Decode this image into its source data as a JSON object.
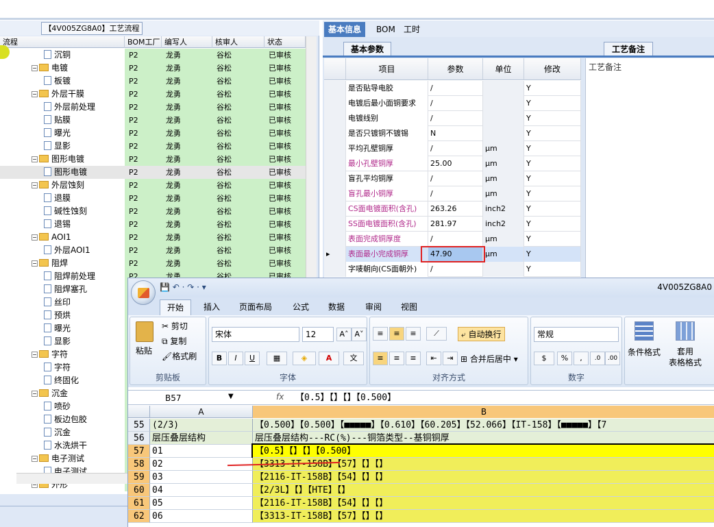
{
  "left_panel": {
    "tab_title": "【4V005ZG8A0】工艺流程",
    "columns": [
      "流程",
      "BOM工厂",
      "编写人",
      "核审人",
      "状态"
    ],
    "rows": [
      {
        "indent": 2,
        "kind": "doc",
        "name": "沉铜",
        "bom": "P2",
        "writer": "龙勇",
        "reviewer": "谷松",
        "status": "已审核"
      },
      {
        "indent": 1,
        "kind": "folder",
        "name": "电镀",
        "bom": "P2",
        "writer": "龙勇",
        "reviewer": "谷松",
        "status": "已审核"
      },
      {
        "indent": 2,
        "kind": "doc",
        "name": "板镀",
        "bom": "P2",
        "writer": "龙勇",
        "reviewer": "谷松",
        "status": "已审核"
      },
      {
        "indent": 1,
        "kind": "folder",
        "name": "外层干膜",
        "bom": "P2",
        "writer": "龙勇",
        "reviewer": "谷松",
        "status": "已审核"
      },
      {
        "indent": 2,
        "kind": "doc",
        "name": "外层前处理",
        "bom": "P2",
        "writer": "龙勇",
        "reviewer": "谷松",
        "status": "已审核"
      },
      {
        "indent": 2,
        "kind": "doc",
        "name": "贴膜",
        "bom": "P2",
        "writer": "龙勇",
        "reviewer": "谷松",
        "status": "已审核"
      },
      {
        "indent": 2,
        "kind": "doc",
        "name": "曝光",
        "bom": "P2",
        "writer": "龙勇",
        "reviewer": "谷松",
        "status": "已审核"
      },
      {
        "indent": 2,
        "kind": "doc",
        "name": "显影",
        "bom": "P2",
        "writer": "龙勇",
        "reviewer": "谷松",
        "status": "已审核"
      },
      {
        "indent": 1,
        "kind": "folder",
        "name": "图形电镀",
        "bom": "P2",
        "writer": "龙勇",
        "reviewer": "谷松",
        "status": "已审核"
      },
      {
        "indent": 2,
        "kind": "doc",
        "name": "图形电镀",
        "bom": "P2",
        "writer": "龙勇",
        "reviewer": "谷松",
        "status": "已审核",
        "selected": true
      },
      {
        "indent": 1,
        "kind": "folder",
        "name": "外层蚀刻",
        "bom": "P2",
        "writer": "龙勇",
        "reviewer": "谷松",
        "status": "已审核"
      },
      {
        "indent": 2,
        "kind": "doc",
        "name": "退膜",
        "bom": "P2",
        "writer": "龙勇",
        "reviewer": "谷松",
        "status": "已审核"
      },
      {
        "indent": 2,
        "kind": "doc",
        "name": "碱性蚀刻",
        "bom": "P2",
        "writer": "龙勇",
        "reviewer": "谷松",
        "status": "已审核"
      },
      {
        "indent": 2,
        "kind": "doc",
        "name": "退锡",
        "bom": "P2",
        "writer": "龙勇",
        "reviewer": "谷松",
        "status": "已审核"
      },
      {
        "indent": 1,
        "kind": "folder",
        "name": "AOI1",
        "bom": "P2",
        "writer": "龙勇",
        "reviewer": "谷松",
        "status": "已审核"
      },
      {
        "indent": 2,
        "kind": "doc",
        "name": "外层AOI1",
        "bom": "P2",
        "writer": "龙勇",
        "reviewer": "谷松",
        "status": "已审核"
      },
      {
        "indent": 1,
        "kind": "folder",
        "name": "阻焊",
        "bom": "P2",
        "writer": "龙勇",
        "reviewer": "谷松",
        "status": "已审核"
      },
      {
        "indent": 2,
        "kind": "doc",
        "name": "阻焊前处理",
        "bom": "P2",
        "writer": "龙勇",
        "reviewer": "谷松",
        "status": "已审核"
      },
      {
        "indent": 2,
        "kind": "doc",
        "name": "阻焊塞孔"
      },
      {
        "indent": 2,
        "kind": "doc",
        "name": "丝印"
      },
      {
        "indent": 2,
        "kind": "doc",
        "name": "预烘"
      },
      {
        "indent": 2,
        "kind": "doc",
        "name": "曝光"
      },
      {
        "indent": 2,
        "kind": "doc",
        "name": "显影"
      },
      {
        "indent": 1,
        "kind": "folder",
        "name": "字符"
      },
      {
        "indent": 2,
        "kind": "doc",
        "name": "字符"
      },
      {
        "indent": 2,
        "kind": "doc",
        "name": "终固化"
      },
      {
        "indent": 1,
        "kind": "folder",
        "name": "沉金"
      },
      {
        "indent": 2,
        "kind": "doc",
        "name": "喷砂"
      },
      {
        "indent": 2,
        "kind": "doc",
        "name": "板边包胶"
      },
      {
        "indent": 2,
        "kind": "doc",
        "name": "沉金"
      },
      {
        "indent": 2,
        "kind": "doc",
        "name": "水洗烘干"
      },
      {
        "indent": 1,
        "kind": "folder",
        "name": "电子测试"
      },
      {
        "indent": 2,
        "kind": "doc",
        "name": "电子测试"
      },
      {
        "indent": 1,
        "kind": "folder",
        "name": "外形"
      }
    ]
  },
  "right_panel": {
    "tabs": [
      "基本信息",
      "BOM",
      "工时"
    ],
    "subtab": "基本参数",
    "notes_tab": "工艺备注",
    "notes_label": "工艺备注",
    "columns": [
      "项目",
      "参数",
      "单位",
      "修改"
    ],
    "rows": [
      {
        "item": "是否贴导电胶",
        "param": "/",
        "unit": "",
        "mod": "Y"
      },
      {
        "item": "电镀后最小面铜要求",
        "param": "/",
        "unit": "",
        "mod": "Y"
      },
      {
        "item": "电镀线别",
        "param": "/",
        "unit": "",
        "mod": "Y"
      },
      {
        "item": "是否只镀铜不镀锡",
        "param": "N",
        "unit": "",
        "mod": "Y"
      },
      {
        "item": "平均孔壁铜厚",
        "param": "/",
        "unit": "μm",
        "mod": "Y"
      },
      {
        "item": "最小孔壁铜厚",
        "param": "25.00",
        "unit": "μm",
        "mod": "Y",
        "pink": true
      },
      {
        "item": "盲孔平均铜厚",
        "param": "/",
        "unit": "μm",
        "mod": "Y"
      },
      {
        "item": "盲孔最小铜厚",
        "param": "/",
        "unit": "μm",
        "mod": "Y",
        "pink": true
      },
      {
        "item": "CS面电镀面积(含孔)",
        "param": "263.26",
        "unit": "inch2",
        "mod": "Y",
        "pink": true
      },
      {
        "item": "SS面电镀面积(含孔)",
        "param": "281.97",
        "unit": "inch2",
        "mod": "Y",
        "pink": true
      },
      {
        "item": "表面完成铜厚度",
        "param": "/",
        "unit": "μm",
        "mod": "Y",
        "pink": true
      },
      {
        "item": "表面最小完成铜厚",
        "param": "47.90",
        "unit": "μm",
        "mod": "Y",
        "pink": true,
        "selected": true
      },
      {
        "item": "字唛朝向(CS面朝外)",
        "param": "/",
        "unit": "",
        "mod": "Y"
      }
    ]
  },
  "excel": {
    "title": "4V005ZG8A0",
    "tabs": [
      "开始",
      "插入",
      "页面布局",
      "公式",
      "数据",
      "审阅",
      "视图"
    ],
    "clipboard": {
      "paste": "粘贴",
      "cut": "剪切",
      "copy": "复制",
      "format_painter": "格式刷",
      "label": "剪贴板"
    },
    "font": {
      "name": "宋体",
      "size": "12",
      "label": "字体",
      "bold": "B",
      "italic": "I",
      "underline": "U"
    },
    "alignment": {
      "wrap": "自动换行",
      "merge": "合并后居中",
      "label": "对齐方式"
    },
    "number": {
      "format": "常规",
      "label": "数字",
      "percent": "%",
      "comma": ","
    },
    "styles": {
      "conditional": "条件格式",
      "table": "套用\n表格格式"
    },
    "name_box": "B57",
    "fx": "fx",
    "formula": "【0.5】【】【】【0.500】",
    "col_a": "A",
    "col_b": "B",
    "rows": [
      {
        "n": "55",
        "a": "(2/3)",
        "b": "【0.500】【0.500】【■■■■■】【0.610】【60.205】【52.066】【IT-158】【■■■■■】【7",
        "style": "green"
      },
      {
        "n": "56",
        "a": "层压叠层结构",
        "b": "层压叠层结构---RC(%)---铜箔类型--基铜铜厚",
        "style": "green"
      },
      {
        "n": "57",
        "a": "01",
        "b": "【0.5】【】【】【0.500】",
        "style": "yel1"
      },
      {
        "n": "58",
        "a": "02",
        "b": "【3313-IT-158B】【57】【】【】",
        "style": "yel"
      },
      {
        "n": "59",
        "a": "03",
        "b": "【2116-IT-158B】【54】【】【】",
        "style": "yel"
      },
      {
        "n": "60",
        "a": "04",
        "b": "【2/3L】【】【HTE】【】",
        "style": "yel"
      },
      {
        "n": "61",
        "a": "05",
        "b": "【2116-IT-158B】【54】【】【】",
        "style": "yel"
      },
      {
        "n": "62",
        "a": "06",
        "b": "【3313-IT-158B】【57】【】【】",
        "style": "yel"
      }
    ]
  },
  "colors": {
    "accent": "#4a7cc0",
    "annotation_red": "#e02020",
    "grid_green": "#ccf0c8"
  }
}
